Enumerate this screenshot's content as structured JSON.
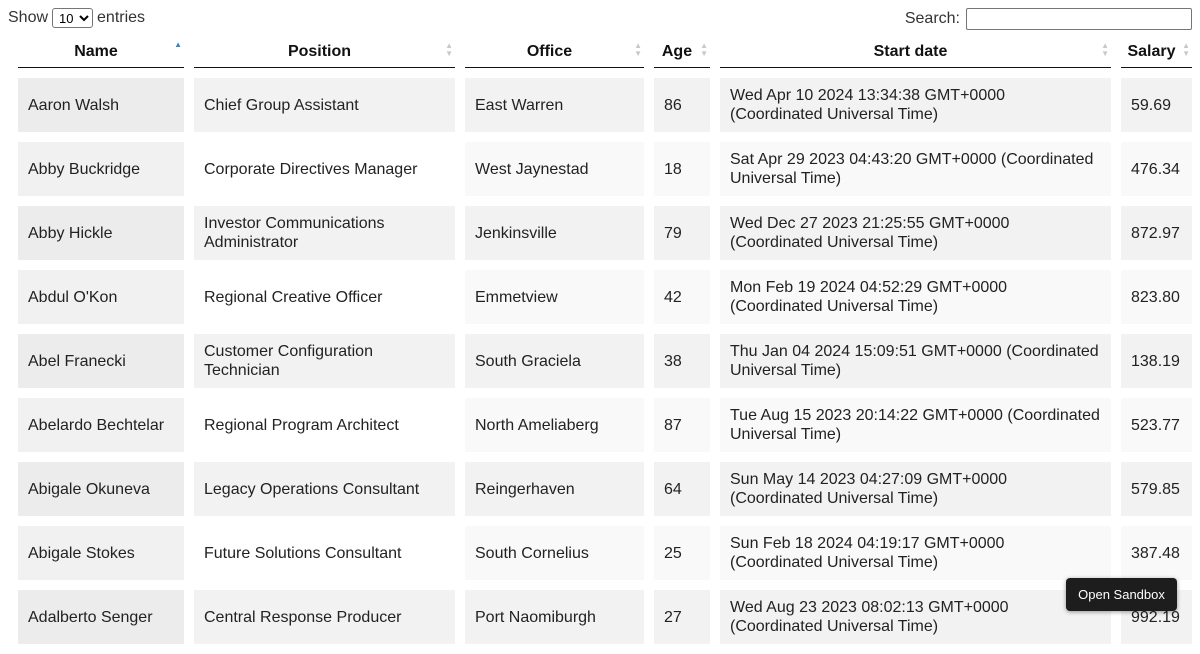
{
  "length": {
    "label_before": "Show",
    "selected": "10",
    "label_after": "entries"
  },
  "search": {
    "label": "Search:",
    "value": "",
    "placeholder": ""
  },
  "columns": [
    {
      "label": "Name",
      "sort": "asc"
    },
    {
      "label": "Position",
      "sort": "none"
    },
    {
      "label": "Office",
      "sort": "none"
    },
    {
      "label": "Age",
      "sort": "none"
    },
    {
      "label": "Start date",
      "sort": "none"
    },
    {
      "label": "Salary",
      "sort": "none"
    }
  ],
  "rows": [
    [
      "Aaron Walsh",
      "Chief Group Assistant",
      "East Warren",
      "86",
      "Wed Apr 10 2024 13:34:38 GMT+0000 (Coordinated Universal Time)",
      "59.69"
    ],
    [
      "Abby Buckridge",
      "Corporate Directives Manager",
      "West Jaynestad",
      "18",
      "Sat Apr 29 2023 04:43:20 GMT+0000 (Coordinated Universal Time)",
      "476.34"
    ],
    [
      "Abby Hickle",
      "Investor Communications Administrator",
      "Jenkinsville",
      "79",
      "Wed Dec 27 2023 21:25:55 GMT+0000 (Coordinated Universal Time)",
      "872.97"
    ],
    [
      "Abdul O'Kon",
      "Regional Creative Officer",
      "Emmetview",
      "42",
      "Mon Feb 19 2024 04:52:29 GMT+0000 (Coordinated Universal Time)",
      "823.80"
    ],
    [
      "Abel Franecki",
      "Customer Configuration Technician",
      "South Graciela",
      "38",
      "Thu Jan 04 2024 15:09:51 GMT+0000 (Coordinated Universal Time)",
      "138.19"
    ],
    [
      "Abelardo Bechtelar",
      "Regional Program Architect",
      "North Ameliaberg",
      "87",
      "Tue Aug 15 2023 20:14:22 GMT+0000 (Coordinated Universal Time)",
      "523.77"
    ],
    [
      "Abigale Okuneva",
      "Legacy Operations Consultant",
      "Reingerhaven",
      "64",
      "Sun May 14 2023 04:27:09 GMT+0000 (Coordinated Universal Time)",
      "579.85"
    ],
    [
      "Abigale Stokes",
      "Future Solutions Consultant",
      "South Cornelius",
      "25",
      "Sun Feb 18 2024 04:19:17 GMT+0000 (Coordinated Universal Time)",
      "387.48"
    ],
    [
      "Adalberto Senger",
      "Central Response Producer",
      "Port Naomiburgh",
      "27",
      "Wed Aug 23 2023 08:02:13 GMT+0000 (Coordinated Universal Time)",
      "992.19"
    ]
  ],
  "sandbox": {
    "label": "Open Sandbox"
  }
}
